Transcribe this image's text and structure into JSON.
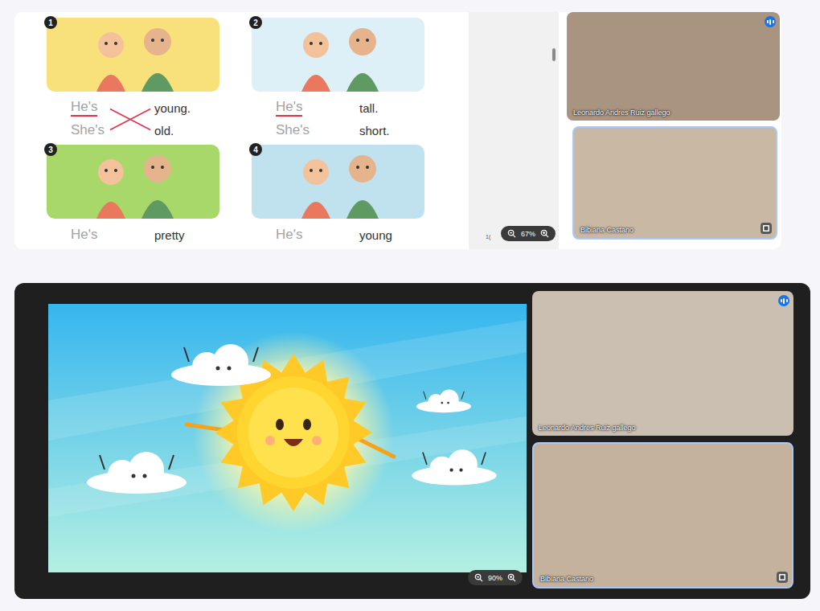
{
  "lesson_view": {
    "worksheet": {
      "exercises": [
        {
          "number": "1",
          "color": "#f8e17a",
          "crossed": true,
          "rows": [
            {
              "subject": "He's",
              "underlined": true,
              "adjective": "young."
            },
            {
              "subject": "She's",
              "underlined": false,
              "adjective": "old."
            }
          ]
        },
        {
          "number": "2",
          "color": "#def0f7",
          "crossed": false,
          "rows": [
            {
              "subject": "He's",
              "underlined": true,
              "adjective": "tall."
            },
            {
              "subject": "She's",
              "underlined": false,
              "adjective": "short."
            }
          ]
        },
        {
          "number": "3",
          "color": "#a8d76a",
          "crossed": false,
          "rows": [
            {
              "subject": "He's",
              "underlined": false,
              "adjective": "pretty"
            }
          ]
        },
        {
          "number": "4",
          "color": "#bfe2ee",
          "crossed": false,
          "rows": [
            {
              "subject": "He's",
              "underlined": false,
              "adjective": "young"
            }
          ]
        }
      ],
      "page_label": "1(",
      "zoom": "67%"
    },
    "participants": [
      {
        "name": "Leonardo Andres Ruiz gallego",
        "speaking": true
      },
      {
        "name": "Bibiana Castano",
        "speaking": false
      }
    ]
  },
  "whiteboard_view": {
    "zoom": "90%",
    "participants": [
      {
        "name": "Leonardo Andres Ruiz gallego",
        "speaking": true
      },
      {
        "name": "Bibiana Castano",
        "speaking": false
      }
    ]
  }
}
